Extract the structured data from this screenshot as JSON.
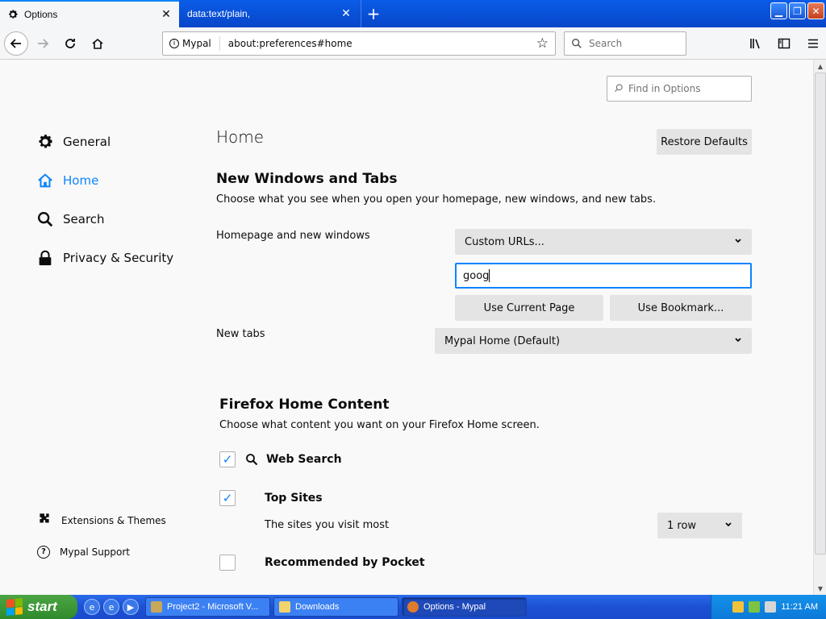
{
  "browser": {
    "tabs": [
      {
        "title": "Options",
        "active": true
      },
      {
        "title": "data:text/plain,",
        "active": false
      }
    ],
    "identity_label": "Mypal",
    "url": "about:preferences#home",
    "search_placeholder": "Search"
  },
  "prefs": {
    "find_placeholder": "Find in Options",
    "sidebar": {
      "items": [
        {
          "label": "General",
          "icon": "gear-icon"
        },
        {
          "label": "Home",
          "icon": "home-icon",
          "active": true
        },
        {
          "label": "Search",
          "icon": "search-icon"
        },
        {
          "label": "Privacy & Security",
          "icon": "lock-icon"
        }
      ],
      "bottom": [
        {
          "label": "Extensions & Themes",
          "icon": "puzzle-icon"
        },
        {
          "label": "Mypal Support",
          "icon": "help-icon"
        }
      ]
    },
    "home": {
      "title": "Home",
      "restore_label": "Restore Defaults",
      "new_windows_title": "New Windows and Tabs",
      "new_windows_desc": "Choose what you see when you open your homepage, new windows, and new tabs.",
      "homepage_label": "Homepage and new windows",
      "homepage_select": "Custom URLs...",
      "homepage_url_value": "goog",
      "use_current_label": "Use Current Page",
      "use_bookmark_label": "Use Bookmark...",
      "newtabs_label": "New tabs",
      "newtabs_select": "Mypal Home (Default)",
      "content_title": "Firefox Home Content",
      "content_desc": "Choose what content you want on your Firefox Home screen.",
      "web_search_label": "Web Search",
      "web_search_checked": true,
      "top_sites_label": "Top Sites",
      "top_sites_checked": true,
      "top_sites_desc": "The sites you visit most",
      "top_sites_rows": "1 row",
      "pocket_label": "Recommended by Pocket",
      "pocket_checked": false
    }
  },
  "taskbar": {
    "start_label": "start",
    "windows": [
      {
        "label": "Project2 - Microsoft V...",
        "active": false
      },
      {
        "label": "Downloads",
        "active": false
      },
      {
        "label": "Options - Mypal",
        "active": true
      }
    ],
    "clock": "11:21 AM"
  },
  "colors": {
    "accent": "#0a84ff",
    "xp_blue": "#0a5ce8",
    "start_green": "#3c9a36"
  }
}
